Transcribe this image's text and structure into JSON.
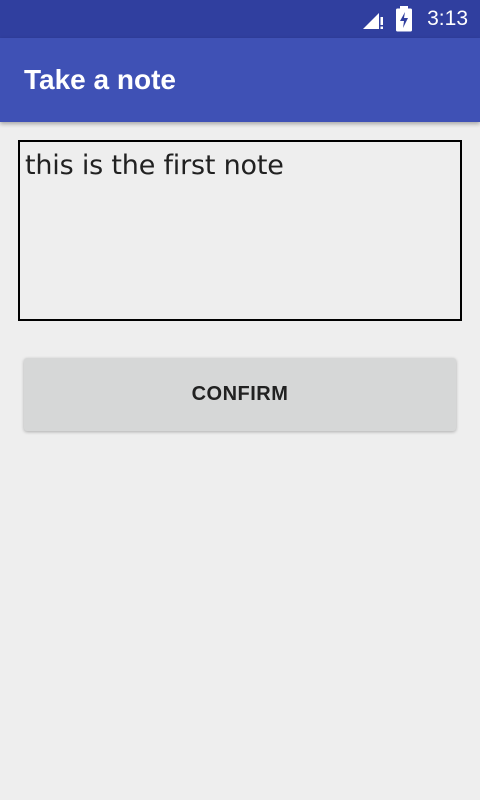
{
  "status_bar": {
    "time": "3:13",
    "icons": [
      "signal-no-data-icon",
      "battery-charging-icon"
    ]
  },
  "app_bar": {
    "title": "Take a note"
  },
  "note": {
    "value": "this is the first note"
  },
  "actions": {
    "confirm_label": "CONFIRM"
  },
  "colors": {
    "status_bar": "#303f9f",
    "app_bar": "#3f51b5",
    "background": "#eeeeee",
    "button": "#d6d7d7"
  }
}
